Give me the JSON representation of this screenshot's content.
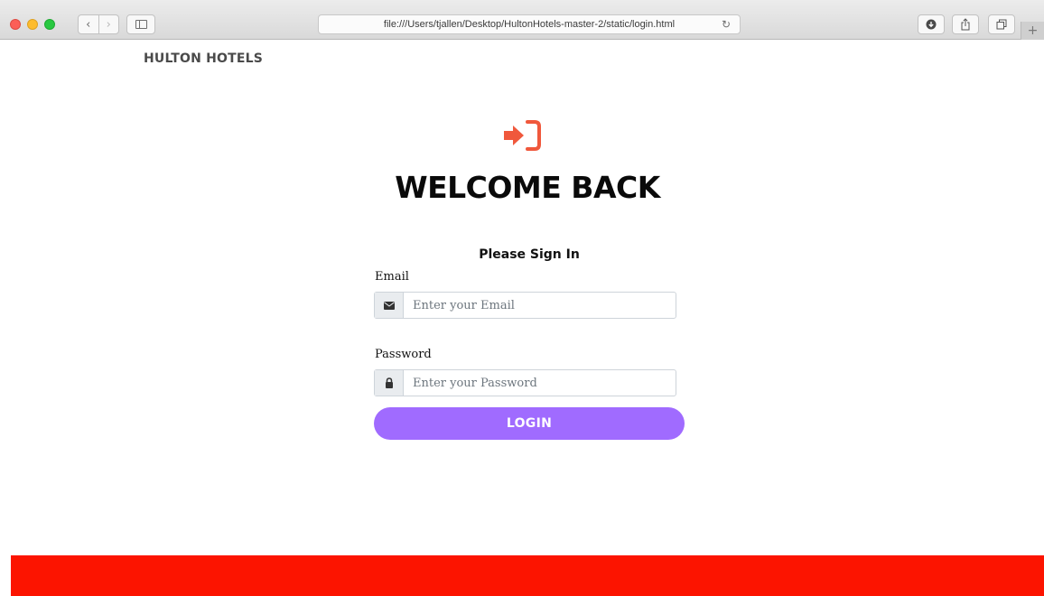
{
  "browser": {
    "url": "file:///Users/tjallen/Desktop/HultonHotels-master-2/static/login.html",
    "back_glyph": "‹",
    "forward_glyph": "›",
    "reload_glyph": "↻",
    "new_tab_glyph": "+",
    "icons": [
      "back-icon",
      "forward-icon",
      "sidebar-icon",
      "reload-icon",
      "download-icon",
      "share-icon",
      "tabs-icon",
      "new-tab-icon"
    ]
  },
  "nav": {
    "brand": "HULTON HOTELS"
  },
  "main": {
    "icon": "sign-in-icon",
    "icon_color": "#f0583c",
    "heading": "WELCOME BACK",
    "sub_heading": "Please Sign In",
    "email": {
      "label": "Email",
      "placeholder": "Enter your Email",
      "icon": "envelope-icon"
    },
    "password": {
      "label": "Password",
      "placeholder": "Enter your Password",
      "icon": "lock-icon"
    },
    "login_label": "LOGIN"
  },
  "colors": {
    "button": "#a06bff",
    "footer": "#fc1400"
  }
}
